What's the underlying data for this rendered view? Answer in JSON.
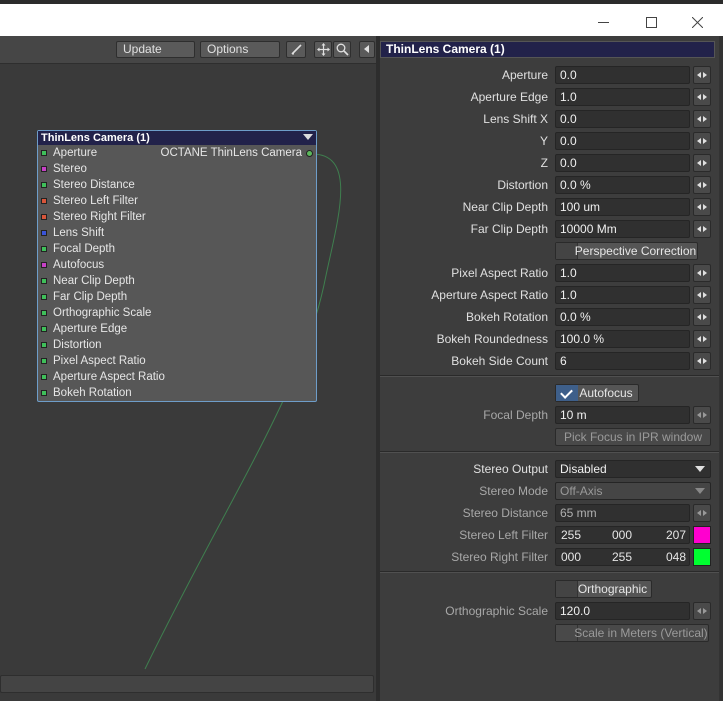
{
  "window": {
    "minimize_icon": "minimize-icon",
    "maximize_icon": "maximize-icon",
    "close_icon": "close-icon"
  },
  "toolbar": {
    "update_label": "Update",
    "options_label": "Options",
    "icons": [
      "pen-icon",
      "move-icon",
      "zoom-icon"
    ]
  },
  "node": {
    "title": "ThinLens Camera (1)",
    "output_label": "OCTANE ThinLens Camera",
    "inputs": [
      {
        "label": "Aperture",
        "color": "#3fbf5a"
      },
      {
        "label": "Stereo",
        "color": "#c640c6"
      },
      {
        "label": "Stereo Distance",
        "color": "#3fbf5a"
      },
      {
        "label": "Stereo Left Filter",
        "color": "#d8553a"
      },
      {
        "label": "Stereo Right Filter",
        "color": "#d8553a"
      },
      {
        "label": "Lens Shift",
        "color": "#3a54d8"
      },
      {
        "label": "Focal Depth",
        "color": "#3fbf5a"
      },
      {
        "label": "Autofocus",
        "color": "#c640c6"
      },
      {
        "label": "Near Clip Depth",
        "color": "#3fbf5a"
      },
      {
        "label": "Far Clip Depth",
        "color": "#3fbf5a"
      },
      {
        "label": "Orthographic Scale",
        "color": "#3fbf5a"
      },
      {
        "label": "Aperture Edge",
        "color": "#3fbf5a"
      },
      {
        "label": "Distortion",
        "color": "#3fbf5a"
      },
      {
        "label": "Pixel Aspect Ratio",
        "color": "#3fbf5a"
      },
      {
        "label": "Aperture Aspect Ratio",
        "color": "#3fbf5a"
      },
      {
        "label": "Bokeh Rotation",
        "color": "#3fbf5a"
      }
    ]
  },
  "panel": {
    "header": "ThinLens Camera (1)",
    "aperture": {
      "label": "Aperture",
      "value": "0.0"
    },
    "aperture_edge": {
      "label": "Aperture Edge",
      "value": "1.0"
    },
    "lens_shift_x": {
      "label": "Lens Shift X",
      "value": "0.0"
    },
    "lens_shift_y": {
      "label": "Y",
      "value": "0.0"
    },
    "lens_shift_z": {
      "label": "Z",
      "value": "0.0"
    },
    "distortion": {
      "label": "Distortion",
      "value": "0.0 %"
    },
    "near_clip": {
      "label": "Near Clip Depth",
      "value": "100 um"
    },
    "far_clip": {
      "label": "Far Clip Depth",
      "value": "10000 Mm"
    },
    "perspective_correction": "Perspective Correction",
    "pixel_aspect": {
      "label": "Pixel Aspect Ratio",
      "value": "1.0"
    },
    "aperture_aspect": {
      "label": "Aperture Aspect Ratio",
      "value": "1.0"
    },
    "bokeh_rotation": {
      "label": "Bokeh Rotation",
      "value": "0.0 %"
    },
    "bokeh_roundedness": {
      "label": "Bokeh Roundedness",
      "value": "100.0 %"
    },
    "bokeh_side_count": {
      "label": "Bokeh Side Count",
      "value": "6"
    },
    "autofocus": "Autofocus",
    "focal_depth": {
      "label": "Focal Depth",
      "value": "10 m"
    },
    "pick_focus": "Pick Focus in IPR window",
    "stereo_output": {
      "label": "Stereo Output",
      "value": "Disabled"
    },
    "stereo_mode": {
      "label": "Stereo Mode",
      "value": "Off-Axis"
    },
    "stereo_distance": {
      "label": "Stereo Distance",
      "value": "65 mm"
    },
    "stereo_left": {
      "label": "Stereo Left Filter",
      "r": "255",
      "g": "000",
      "b": "207",
      "color": "#ff00cf"
    },
    "stereo_right": {
      "label": "Stereo Right Filter",
      "r": "000",
      "g": "255",
      "b": "048",
      "color": "#00ff30"
    },
    "orthographic": "Orthographic",
    "ortho_scale": {
      "label": "Orthographic Scale",
      "value": "120.0"
    },
    "scale_meters": "Scale in Meters (Vertical)"
  }
}
